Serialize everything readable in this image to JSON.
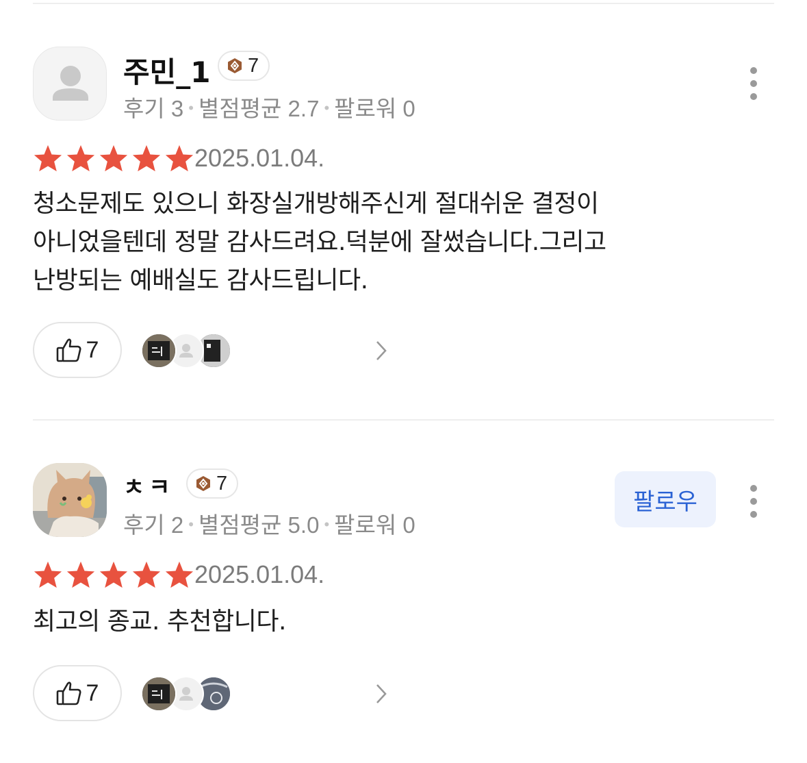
{
  "reviews": [
    {
      "username": "주민_1",
      "level": "7",
      "avatar_type": "default-profile-icon",
      "stats": {
        "reviews": "후기 3",
        "avg_rating": "별점평균 2.7",
        "followers": "팔로워 0"
      },
      "rating": 5,
      "date": "2025.01.04.",
      "content": "청소문제도 있으니 화장실개방해주신게 절대쉬운 결정이\n아니었을텐데 정말 감사드려요.덕분에 잘썼습니다.그리고\n난방되는 예배실도 감사드립니다.",
      "likes": "7",
      "show_follow": false
    },
    {
      "username": "ㅊㅋ",
      "level": "7",
      "avatar_type": "cat-illustration",
      "stats": {
        "reviews": "후기 2",
        "avg_rating": "별점평균 5.0",
        "followers": "팔로워 0"
      },
      "rating": 5,
      "date": "2025.01.04.",
      "content": "최고의 종교. 추천합니다.",
      "likes": "7",
      "show_follow": true,
      "follow_label": "팔로우"
    }
  ],
  "colors": {
    "star": "#e8523f",
    "badge_hex": "#9a5a33",
    "follow_bg": "#edf2fd",
    "follow_text": "#2a62d4"
  },
  "icons": {
    "more": "more-vertical-icon",
    "like": "thumbs-up-icon",
    "chevron": "chevron-right-icon",
    "level": "level-hexagon-icon"
  }
}
